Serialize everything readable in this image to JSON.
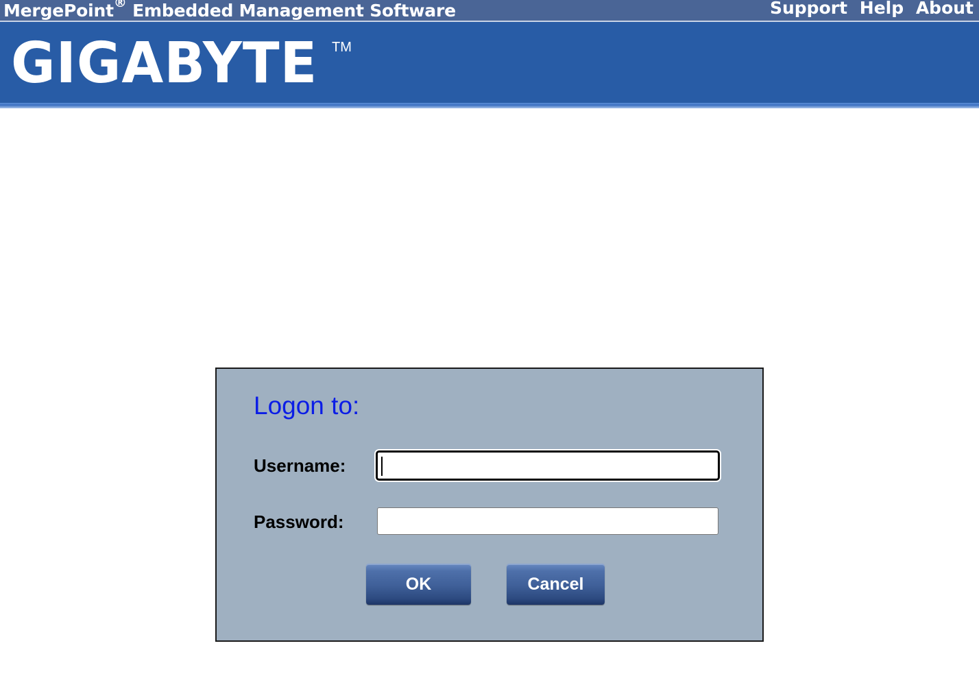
{
  "header": {
    "app_title": "MergePoint",
    "registered_mark": "®",
    "app_subtitle": " Embedded Management Software",
    "links": {
      "support": "Support",
      "help": "Help",
      "about": "About"
    }
  },
  "banner": {
    "logo_text": "GIGABYTE",
    "trademark": "TM"
  },
  "login": {
    "title": "Logon to:",
    "username_label": "Username:",
    "username_value": "",
    "password_label": "Password:",
    "password_value": "",
    "ok_label": "OK",
    "cancel_label": "Cancel"
  },
  "colors": {
    "topbar": "#4a6596",
    "banner": "#285ca6",
    "dialog_bg": "#9fb0c1",
    "title_text": "#0b1de6"
  }
}
